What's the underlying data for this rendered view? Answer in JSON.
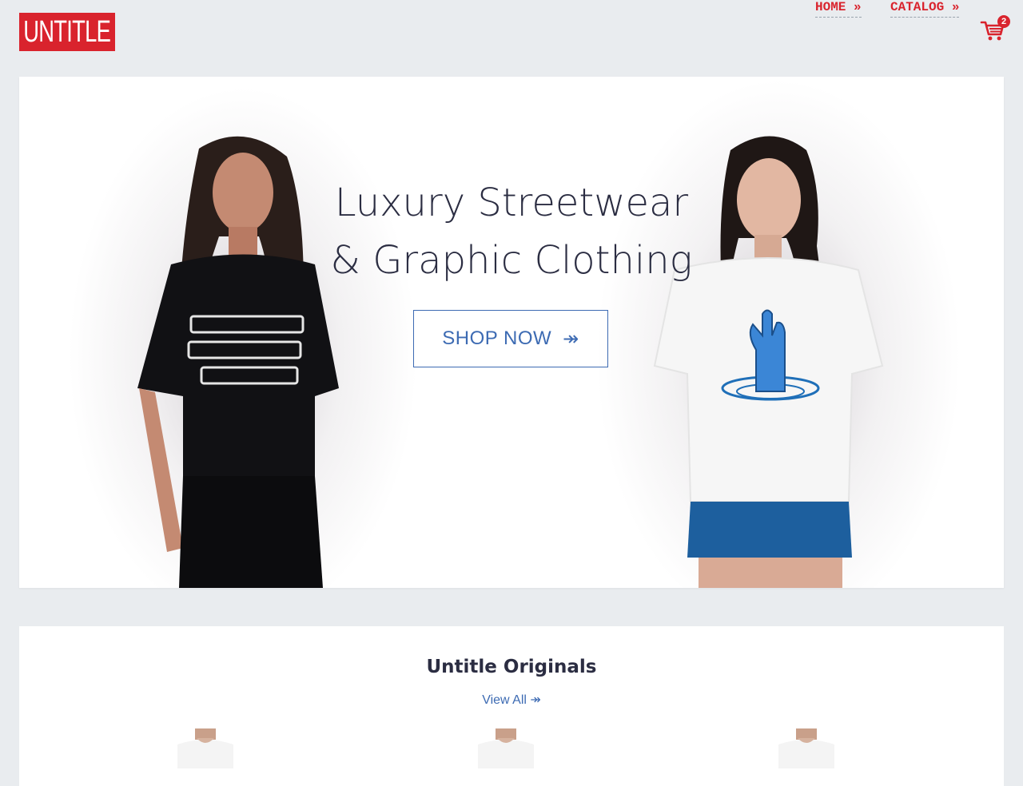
{
  "header": {
    "logo_text": "UNTITLE",
    "nav": [
      {
        "label": "HOME »"
      },
      {
        "label": "CATALOG »"
      }
    ],
    "cart_icon": "shopping-cart-icon",
    "cart_count": "2"
  },
  "hero": {
    "title_line1": "Luxury Streetwear",
    "title_line2": "& Graphic Clothing",
    "cta_label": "SHOP NOW",
    "cta_arrow": "↠"
  },
  "originals": {
    "title": "Untitle Originals",
    "view_all": "View All ↠"
  },
  "colors": {
    "brand_red": "#d9232d",
    "accent_blue": "#3d6bb3",
    "text_dark": "#2b2d42",
    "page_bg": "#e9ecef"
  }
}
